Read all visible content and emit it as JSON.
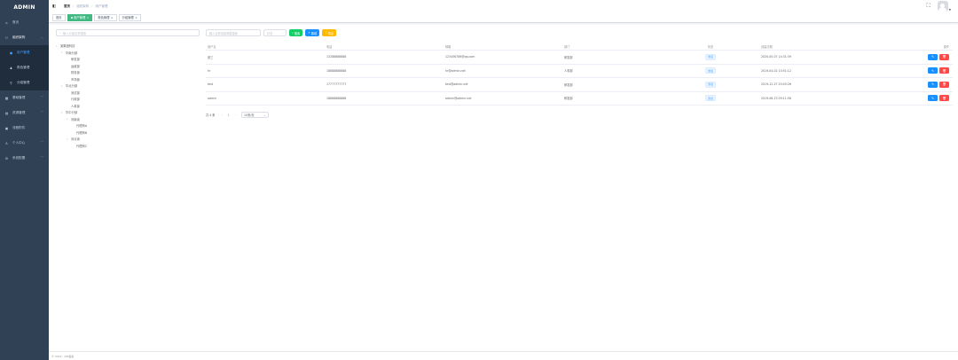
{
  "sidebar": {
    "logo": "ADMIN",
    "items": [
      {
        "label": "首页",
        "icon": "home-icon"
      },
      {
        "label": "组织架构",
        "icon": "org-icon",
        "expanded": true
      },
      {
        "label": "基础管理",
        "icon": "base-icon"
      },
      {
        "label": "资源管理",
        "icon": "resource-icon"
      },
      {
        "label": "流程附件",
        "icon": "attach-icon"
      },
      {
        "label": "个人中心",
        "icon": "user-icon"
      },
      {
        "label": "系统配置",
        "icon": "config-icon"
      }
    ],
    "submenu": [
      {
        "label": "用户管理",
        "active": true
      },
      {
        "label": "角色管理"
      },
      {
        "label": "分组管理"
      }
    ]
  },
  "navbar": {
    "breadcrumb": [
      "首页",
      "组织架构",
      "用户管理"
    ]
  },
  "tags": [
    {
      "label": "首页"
    },
    {
      "label": "用户管理",
      "active": true
    },
    {
      "label": "角色管理"
    },
    {
      "label": "分组管理"
    }
  ],
  "tree": {
    "search_placeholder": "输入分组名称搜索",
    "nodes": [
      {
        "label": "某集团科技",
        "level": 0,
        "toggle": "▾"
      },
      {
        "label": "华南分部",
        "level": 1,
        "toggle": "▾"
      },
      {
        "label": "研发部",
        "level": 2
      },
      {
        "label": "运维部",
        "level": 2
      },
      {
        "label": "财务部",
        "level": 2
      },
      {
        "label": "市场部",
        "level": 2
      },
      {
        "label": "华北分部",
        "level": 1,
        "toggle": "▾"
      },
      {
        "label": "测试部",
        "level": 2
      },
      {
        "label": "行政部",
        "level": 2
      },
      {
        "label": "人事部",
        "level": 2
      },
      {
        "label": "华中分部",
        "level": 1,
        "toggle": "▾"
      },
      {
        "label": "河南省",
        "level": 2,
        "toggle": "▾"
      },
      {
        "label": "代理商A",
        "level": 3
      },
      {
        "label": "代理商B",
        "level": 3
      },
      {
        "label": "河北省",
        "level": 2,
        "toggle": "▾"
      },
      {
        "label": "代理商C",
        "level": 3
      }
    ]
  },
  "filters": {
    "keyword_placeholder": "输入名称或者邮箱搜索",
    "status_placeholder": "状态",
    "search_label": "搜索",
    "add_label": "新增",
    "export_label": "导出"
  },
  "table": {
    "columns": [
      "用户名",
      "电话",
      "邮箱",
      "部门",
      "状态",
      "创建日期",
      "操作"
    ],
    "rows": [
      {
        "username": "张三",
        "phone": "13288888888",
        "email": "123456789@qq.com",
        "dept": "研发部",
        "status": "激活",
        "created": "2020-05-07 14:31:39"
      },
      {
        "username": "hr",
        "phone": "18888888888",
        "email": "hr@admin.net",
        "dept": "人事部",
        "status": "激活",
        "created": "2019-04-02 10:51:12"
      },
      {
        "username": "test",
        "phone": "17777777777",
        "email": "test@admin.net",
        "dept": "研发部",
        "status": "激活",
        "created": "2019-12-27 20:05:26"
      },
      {
        "username": "admin",
        "phone": "18888888888",
        "email": "admin@admin.net",
        "dept": "研发部",
        "status": "激活",
        "created": "2019-08-23 09:11:56"
      }
    ],
    "edit_glyph": "✎",
    "delete_glyph": "🗑"
  },
  "pagination": {
    "total": "共 4 条",
    "page": "1",
    "page_size": "10条/页"
  },
  "footer": {
    "text": "© 2019 · ICP备案"
  }
}
